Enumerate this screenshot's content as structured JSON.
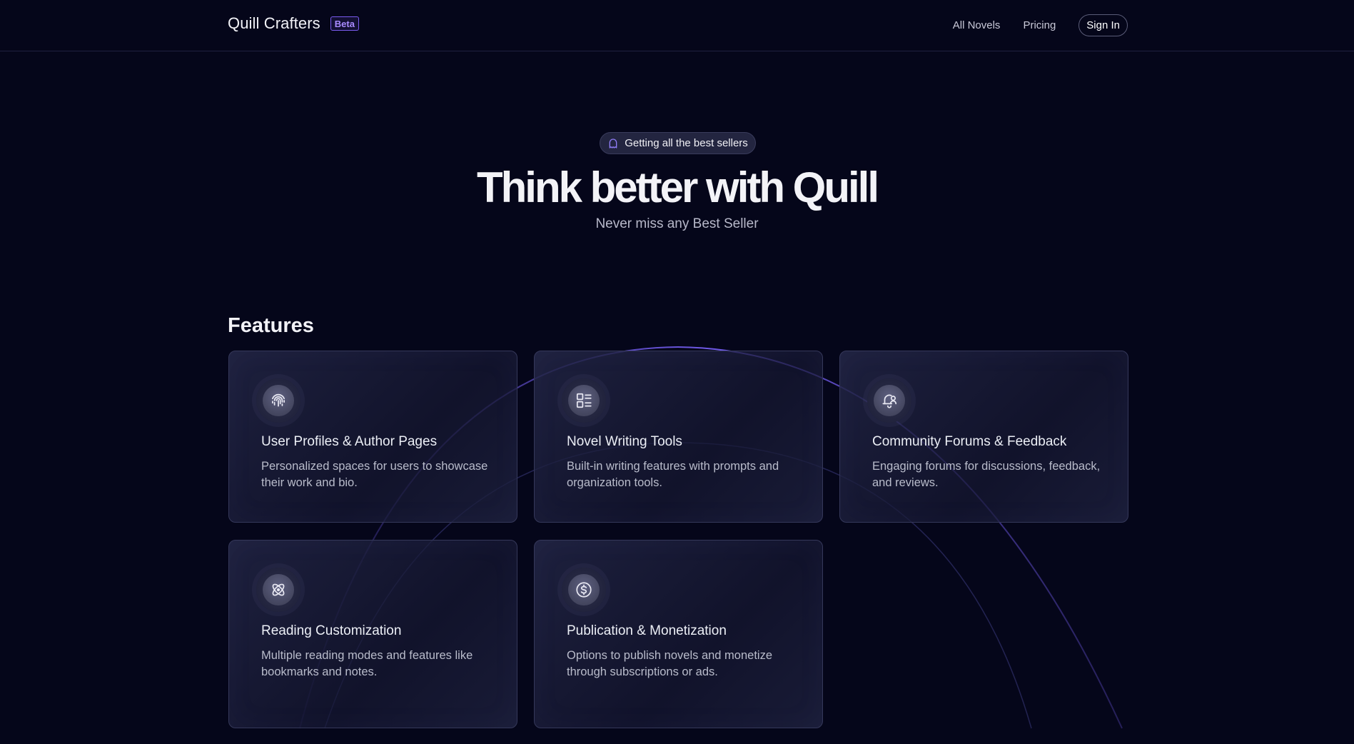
{
  "header": {
    "brand_name": "Quill Crafters",
    "badge": "Beta",
    "nav": [
      {
        "label": "All Novels"
      },
      {
        "label": "Pricing"
      }
    ],
    "signin_label": "Sign In"
  },
  "hero": {
    "pill_icon": "ghost-icon",
    "pill_text": "Getting all the best sellers",
    "title": "Think better with Quill",
    "subtitle": "Never miss any Best Seller"
  },
  "features": {
    "heading": "Features",
    "cards": [
      {
        "icon": "fingerprint-icon",
        "title": "User Profiles & Author Pages",
        "description": "Personalized spaces for users to showcase their work and bio."
      },
      {
        "icon": "dashboard-icon",
        "title": "Novel Writing Tools",
        "description": "Built-in writing features with prompts and organization tools."
      },
      {
        "icon": "bell-user-icon",
        "title": "Community Forums & Feedback",
        "description": "Engaging forums for discussions, feedback, and reviews."
      },
      {
        "icon": "atom-icon",
        "title": "Reading Customization",
        "description": "Multiple reading modes and features like bookmarks and notes."
      },
      {
        "icon": "dollar-circle-icon",
        "title": "Publication & Monetization",
        "description": "Options to publish novels and monetize through subscriptions or ads."
      }
    ]
  },
  "colors": {
    "background": "#05061a",
    "accent": "#7b5cf0",
    "card_border": "#35385a"
  }
}
